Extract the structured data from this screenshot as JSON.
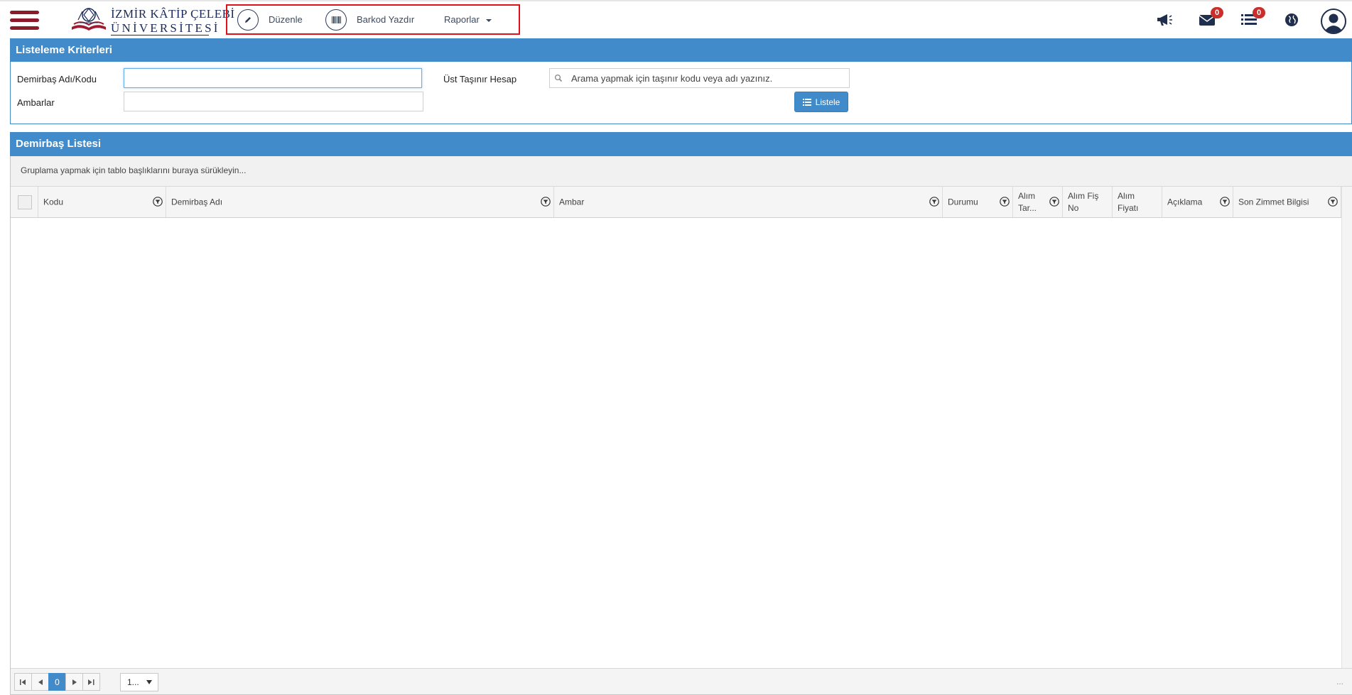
{
  "header": {
    "logo_line1": "İZMİR KÂTİP ÇELEBİ",
    "logo_line2": "ÜNİVERSİTESİ",
    "toolbar": {
      "edit_label": "Düzenle",
      "barcode_label": "Barkod Yazdır",
      "reports_label": "Raporlar"
    },
    "icons": {
      "announcements": "megaphone-icon",
      "messages": "envelope-icon",
      "tasks": "list-icon",
      "language": "globe-icon",
      "profile": "user-icon"
    },
    "messages_count": "0",
    "tasks_count": "0"
  },
  "criteria": {
    "title": "Listeleme Kriterleri",
    "asset_label": "Demirbaş Adı/Kodu",
    "asset_value": "",
    "warehouses_label": "Ambarlar",
    "warehouses_value": "",
    "parent_account_label": "Üst Taşınır Hesap",
    "parent_account_placeholder": "Arama yapmak için taşınır kodu veya adı yazınız.",
    "list_button": "Listele"
  },
  "grid": {
    "title": "Demirbaş Listesi",
    "group_hint": "Gruplama yapmak için tablo başlıklarını buraya sürükleyin...",
    "columns": [
      "Kodu",
      "Demirbaş Adı",
      "Ambar",
      "Durumu",
      "Alım Tar...",
      "Alım Fiş No",
      "Alım Fiyatı",
      "Açıklama",
      "Son Zimmet Bilgisi"
    ],
    "column_lines": {
      "alim_tar": [
        "Alım",
        "Tar..."
      ],
      "alim_fis": [
        "Alım Fiş",
        "No"
      ],
      "alim_fiyat": [
        "Alım",
        "Fiyatı"
      ]
    },
    "rows": [],
    "pager": {
      "current_page": "0",
      "page_size": "1...",
      "info": "..."
    }
  },
  "colors": {
    "brand_red": "#8b1a2b",
    "panel_blue": "#428bca",
    "highlight_border": "#e0111a",
    "badge_red": "#c9302c"
  }
}
